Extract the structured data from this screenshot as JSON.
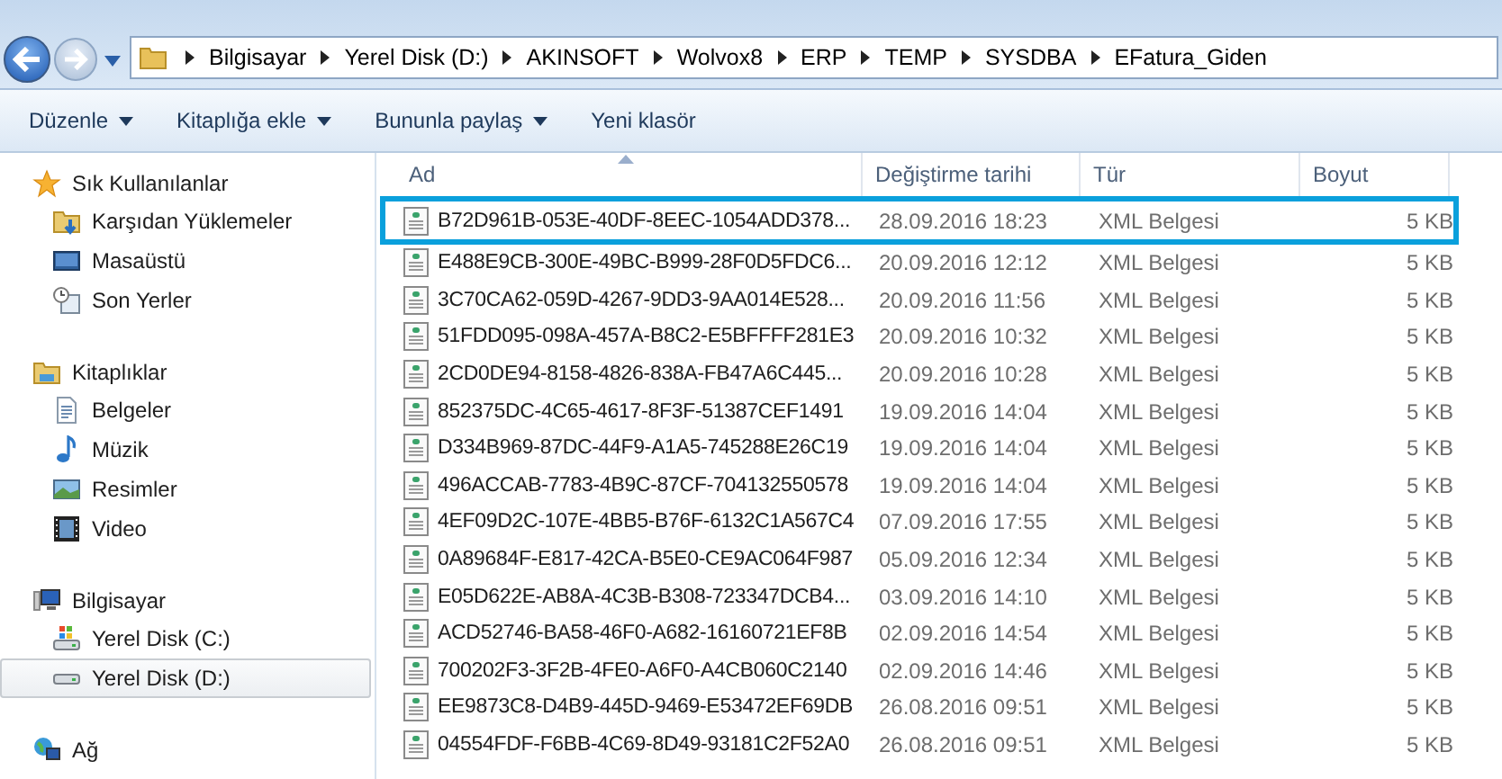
{
  "address_bar": {
    "segments": [
      "Bilgisayar",
      "Yerel Disk (D:)",
      "AKINSOFT",
      "Wolvox8",
      "ERP",
      "TEMP",
      "SYSDBA",
      "EFatura_Giden"
    ]
  },
  "toolbar": [
    {
      "label": "Düzenle",
      "dropdown": true
    },
    {
      "label": "Kitaplığa ekle",
      "dropdown": true
    },
    {
      "label": "Bununla paylaş",
      "dropdown": true
    },
    {
      "label": "Yeni klasör",
      "dropdown": false
    }
  ],
  "sidebar": {
    "groups": [
      {
        "label": "Sık Kullanılanlar",
        "kind": "favorites",
        "children": [
          {
            "label": "Karşıdan Yüklemeler",
            "kind": "downloads",
            "selected": false
          },
          {
            "label": "Masaüstü",
            "kind": "desktop",
            "selected": false
          },
          {
            "label": "Son Yerler",
            "kind": "recent",
            "selected": false
          }
        ]
      },
      {
        "label": "Kitaplıklar",
        "kind": "libraries",
        "children": [
          {
            "label": "Belgeler",
            "kind": "documents",
            "selected": false
          },
          {
            "label": "Müzik",
            "kind": "music",
            "selected": false
          },
          {
            "label": "Resimler",
            "kind": "pictures",
            "selected": false
          },
          {
            "label": "Video",
            "kind": "video",
            "selected": false
          }
        ]
      },
      {
        "label": "Bilgisayar",
        "kind": "computer",
        "children": [
          {
            "label": "Yerel Disk (C:)",
            "kind": "system-disk",
            "selected": false
          },
          {
            "label": "Yerel Disk (D:)",
            "kind": "disk",
            "selected": true
          }
        ]
      },
      {
        "label": "Ağ",
        "kind": "network"
      }
    ]
  },
  "table": {
    "columns": [
      "Ad",
      "Değiştirme tarihi",
      "Tür",
      "Boyut"
    ],
    "rows": [
      {
        "name": "B72D961B-053E-40DF-8EEC-1054ADD378...",
        "date": "28.09.2016 18:23",
        "type": "XML Belgesi",
        "size": "5 KB",
        "selected": true
      },
      {
        "name": "E488E9CB-300E-49BC-B999-28F0D5FDC6...",
        "date": "20.09.2016 12:12",
        "type": "XML Belgesi",
        "size": "5 KB",
        "selected": false
      },
      {
        "name": "3C70CA62-059D-4267-9DD3-9AA014E528...",
        "date": "20.09.2016 11:56",
        "type": "XML Belgesi",
        "size": "5 KB",
        "selected": false
      },
      {
        "name": "51FDD095-098A-457A-B8C2-E5BFFFF281E3",
        "date": "20.09.2016 10:32",
        "type": "XML Belgesi",
        "size": "5 KB",
        "selected": false
      },
      {
        "name": "2CD0DE94-8158-4826-838A-FB47A6C445...",
        "date": "20.09.2016 10:28",
        "type": "XML Belgesi",
        "size": "5 KB",
        "selected": false
      },
      {
        "name": "852375DC-4C65-4617-8F3F-51387CEF1491",
        "date": "19.09.2016 14:04",
        "type": "XML Belgesi",
        "size": "5 KB",
        "selected": false
      },
      {
        "name": "D334B969-87DC-44F9-A1A5-745288E26C19",
        "date": "19.09.2016 14:04",
        "type": "XML Belgesi",
        "size": "5 KB",
        "selected": false
      },
      {
        "name": "496ACCAB-7783-4B9C-87CF-704132550578",
        "date": "19.09.2016 14:04",
        "type": "XML Belgesi",
        "size": "5 KB",
        "selected": false
      },
      {
        "name": "4EF09D2C-107E-4BB5-B76F-6132C1A567C4",
        "date": "07.09.2016 17:55",
        "type": "XML Belgesi",
        "size": "5 KB",
        "selected": false
      },
      {
        "name": "0A89684F-E817-42CA-B5E0-CE9AC064F987",
        "date": "05.09.2016 12:34",
        "type": "XML Belgesi",
        "size": "5 KB",
        "selected": false
      },
      {
        "name": "E05D622E-AB8A-4C3B-B308-723347DCB4...",
        "date": "03.09.2016 14:10",
        "type": "XML Belgesi",
        "size": "5 KB",
        "selected": false
      },
      {
        "name": "ACD52746-BA58-46F0-A682-16160721EF8B",
        "date": "02.09.2016 14:54",
        "type": "XML Belgesi",
        "size": "5 KB",
        "selected": false
      },
      {
        "name": "700202F3-3F2B-4FE0-A6F0-A4CB060C2140",
        "date": "02.09.2016 14:46",
        "type": "XML Belgesi",
        "size": "5 KB",
        "selected": false
      },
      {
        "name": "EE9873C8-D4B9-445D-9469-E53472EF69DB",
        "date": "26.08.2016 09:51",
        "type": "XML Belgesi",
        "size": "5 KB",
        "selected": false
      },
      {
        "name": "04554FDF-F6BB-4C69-8D49-93181C2F52A0",
        "date": "26.08.2016 09:51",
        "type": "XML Belgesi",
        "size": "5 KB",
        "selected": false
      }
    ]
  }
}
